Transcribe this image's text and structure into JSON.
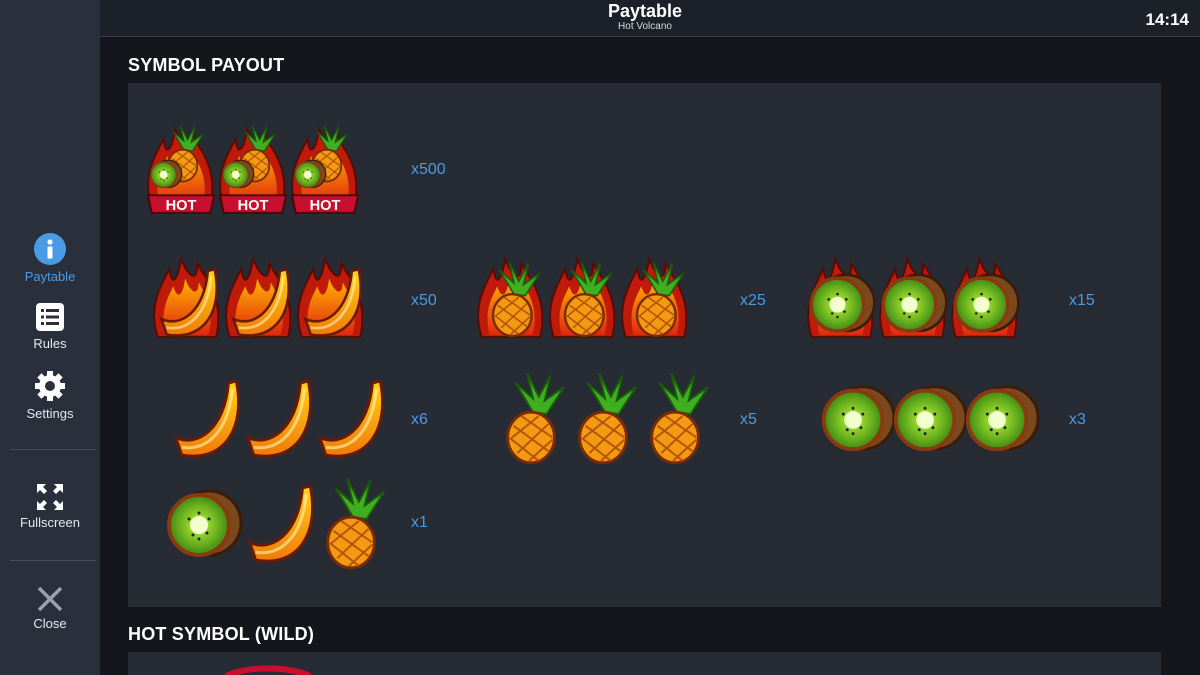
{
  "header": {
    "title": "Paytable",
    "subtitle": "Hot Volcano",
    "clock": "14:14"
  },
  "sidebar": {
    "items": [
      {
        "label": "Paytable",
        "icon": "info-icon",
        "active": true
      },
      {
        "label": "Rules",
        "icon": "list-icon"
      },
      {
        "label": "Settings",
        "icon": "gear-icon"
      },
      {
        "label": "Fullscreen",
        "icon": "fullscreen-icon"
      },
      {
        "label": "Close",
        "icon": "close-icon"
      }
    ]
  },
  "sections": {
    "symbol_payout": "SYMBOL PAYOUT",
    "hot_symbol": "HOT SYMBOL (WILD)"
  },
  "payouts": [
    {
      "symbols": "hot-wild x3",
      "multiplier": "x500"
    },
    {
      "symbols": "hot-banana x3",
      "multiplier": "x50"
    },
    {
      "symbols": "hot-pineapple x3",
      "multiplier": "x25"
    },
    {
      "symbols": "hot-kiwi x3",
      "multiplier": "x15"
    },
    {
      "symbols": "banana x3",
      "multiplier": "x6"
    },
    {
      "symbols": "pineapple x3",
      "multiplier": "x5"
    },
    {
      "symbols": "kiwi x3",
      "multiplier": "x3"
    },
    {
      "symbols": "kiwi, banana, pineapple",
      "multiplier": "x1"
    }
  ],
  "colors": {
    "accent": "#4a9be6",
    "panel": "#262b34",
    "sidebar": "#2a303b"
  }
}
